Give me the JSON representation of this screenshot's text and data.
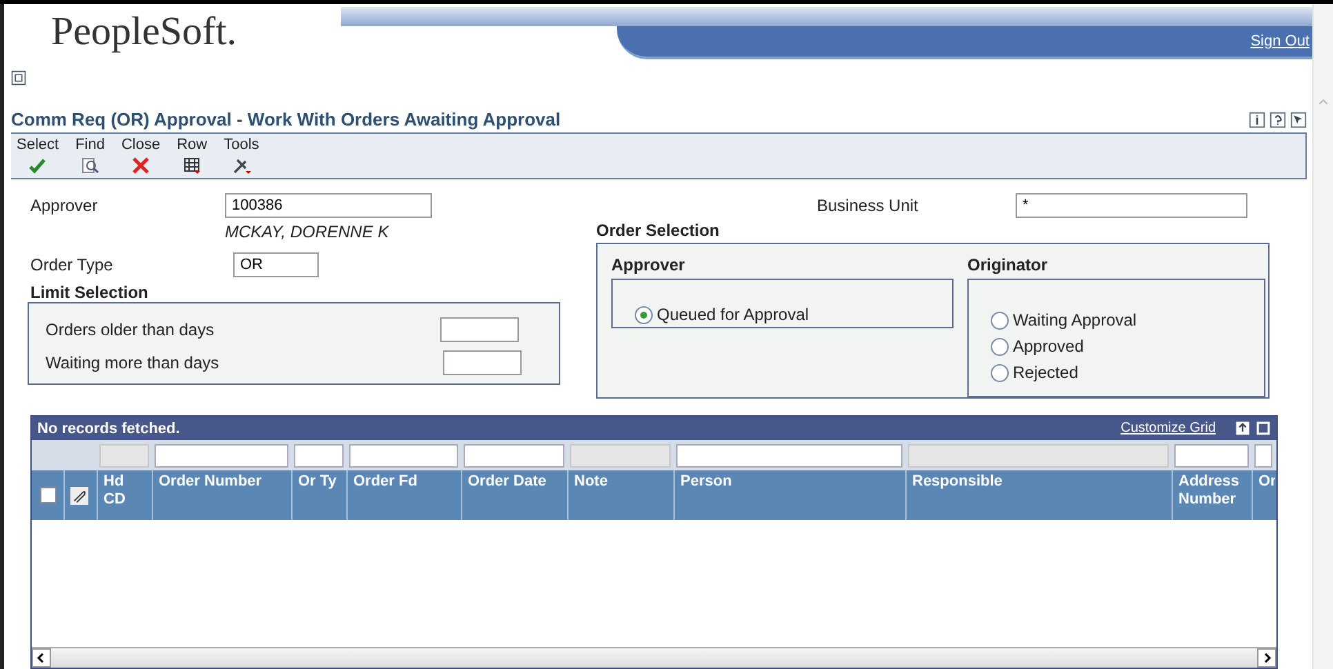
{
  "header": {
    "logo": "PeopleSoft.",
    "sign_out": "Sign Out"
  },
  "form_title": "Comm Req (OR) Approval - Work With Orders Awaiting Approval",
  "toolbar": [
    {
      "label": "Select",
      "kind": "check"
    },
    {
      "label": "Find",
      "kind": "find"
    },
    {
      "label": "Close",
      "kind": "close"
    },
    {
      "label": "Row",
      "kind": "row"
    },
    {
      "label": "Tools",
      "kind": "tools"
    }
  ],
  "approver": {
    "label": "Approver",
    "value": "100386",
    "name": "MCKAY, DORENNE K"
  },
  "business_unit": {
    "label": "Business Unit",
    "value": "*"
  },
  "order_type": {
    "label": "Order Type",
    "value": "OR"
  },
  "limit_selection": {
    "title": "Limit Selection",
    "fields": [
      {
        "label": "Orders older than days"
      },
      {
        "label": "Waiting more than days"
      }
    ]
  },
  "order_selection": {
    "title": "Order Selection",
    "groups": [
      {
        "title": "Approver",
        "options": [
          {
            "label": "Queued for Approval",
            "selected": true
          }
        ]
      },
      {
        "title": "Originator",
        "options": [
          {
            "label": "Waiting Approval",
            "selected": false
          },
          {
            "label": "Approved",
            "selected": false
          },
          {
            "label": "Rejected",
            "selected": false
          }
        ]
      }
    ]
  },
  "grid": {
    "status": "No records fetched.",
    "select_all_checked": false,
    "customize": "Customize Grid",
    "columns": [
      {
        "label": "Hd CD",
        "filter_disabled": true
      },
      {
        "label": "Order Number",
        "filter_disabled": false
      },
      {
        "label": "Or Ty",
        "filter_disabled": false
      },
      {
        "label": "Order Fd",
        "filter_disabled": false
      },
      {
        "label": "Order Date",
        "filter_disabled": false
      },
      {
        "label": "Note",
        "filter_disabled": true
      },
      {
        "label": "Person",
        "filter_disabled": false
      },
      {
        "label": "Responsible",
        "filter_disabled": true
      },
      {
        "label": "Address Number",
        "filter_disabled": false
      },
      {
        "label": "Or",
        "filter_disabled": false
      }
    ]
  }
}
